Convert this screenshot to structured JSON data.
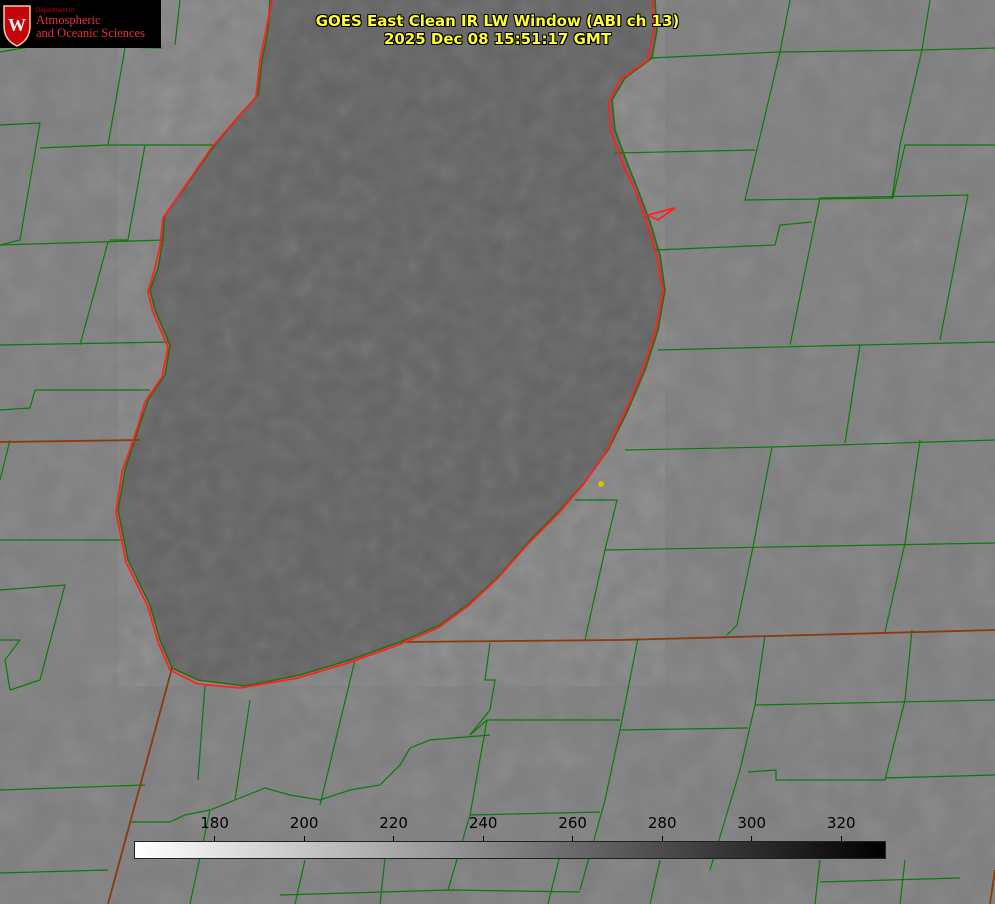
{
  "title": {
    "line1": "GOES East Clean IR LW Window (ABI ch 13)",
    "line2": "2025 Dec 08 15:51:17 GMT"
  },
  "logo": {
    "dept": "Department of",
    "line1": "Atmospheric",
    "line2": "and Oceanic Sciences",
    "crest": "W"
  },
  "colorbar": {
    "min": 162,
    "max": 330,
    "ticks": [
      "180",
      "200",
      "220",
      "240",
      "260",
      "280",
      "300",
      "320"
    ],
    "gradient_from": "#ffffff",
    "gradient_to": "#000000"
  },
  "colors": {
    "background": "#7e7e7e",
    "lake": "#616161",
    "county_lines": "#0a7a0a",
    "state_lines": "#8b3a0a",
    "shoreline": "#ff2020",
    "title": "#ffff33",
    "marker": "#d8c000"
  }
}
